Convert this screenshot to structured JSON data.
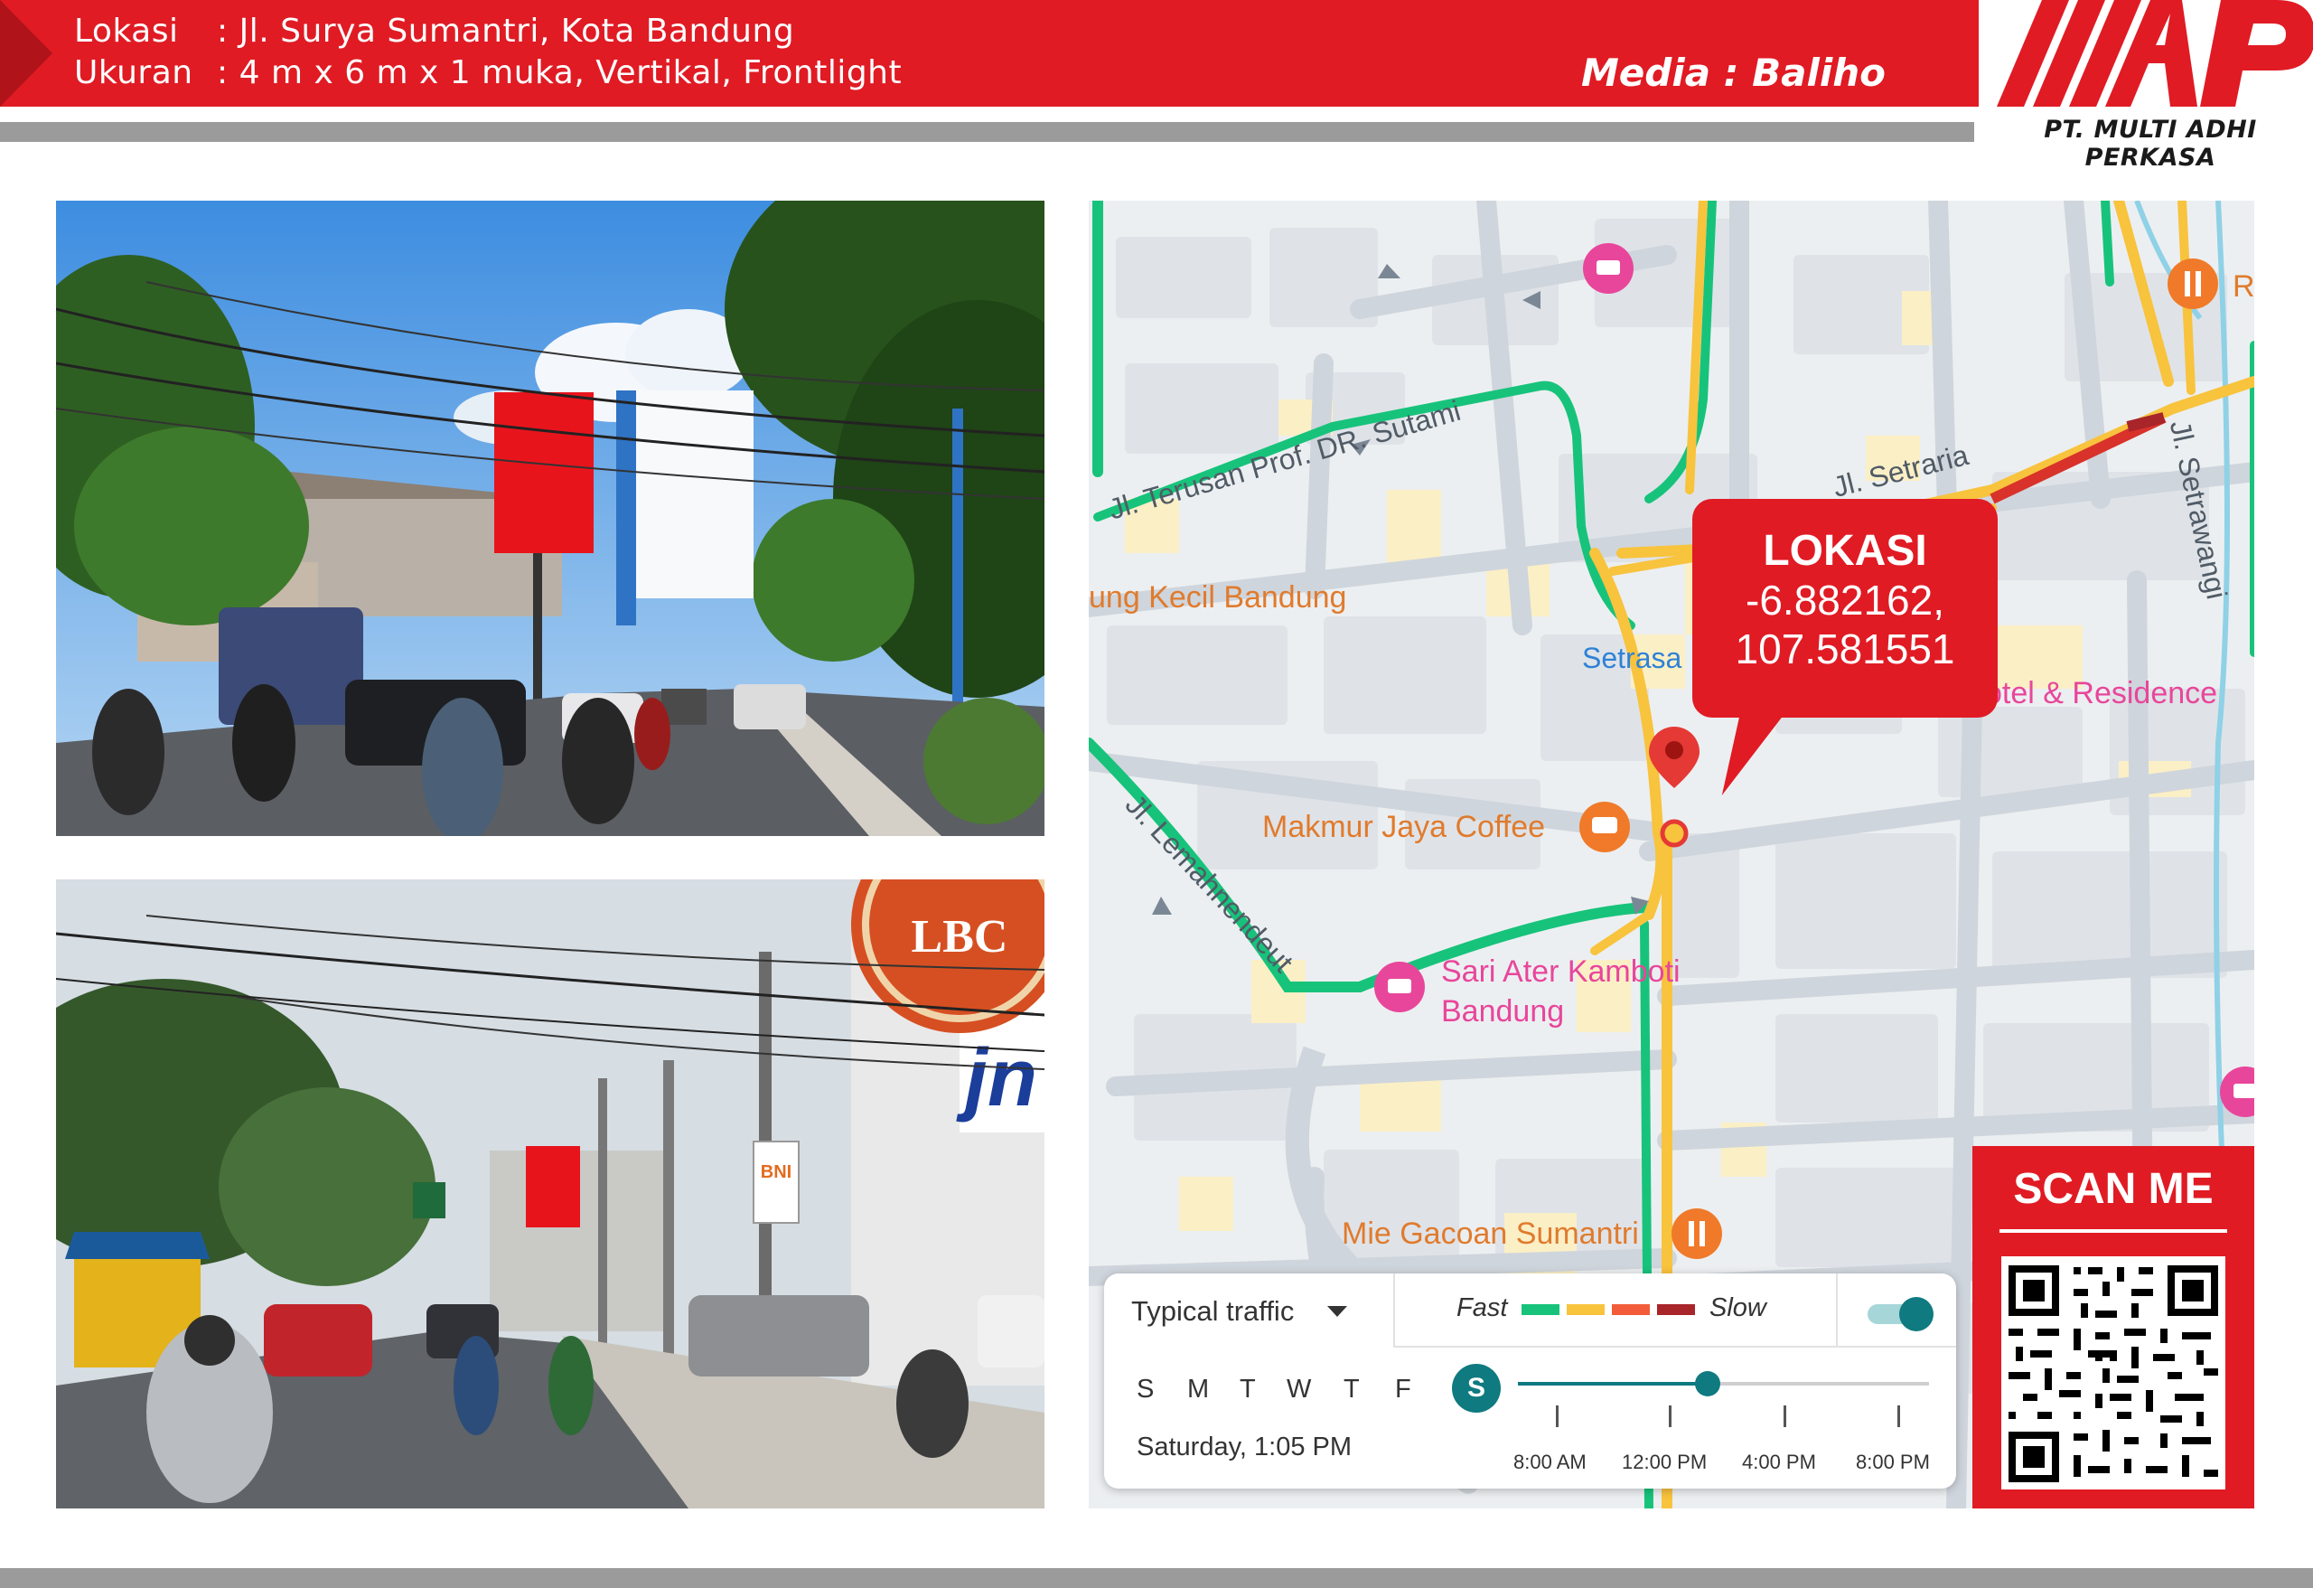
{
  "header": {
    "lokasi_label": "Lokasi",
    "lokasi_sep": ":",
    "lokasi_value": "Jl. Surya Sumantri, Kota Bandung",
    "ukuran_label": "Ukuran",
    "ukuran_sep": ":",
    "ukuran_value": "4 m x 6 m x 1 muka, Vertikal, Frontlight",
    "media": "Media : Baliho",
    "logo_text": "MAP",
    "company": "PT. MULTI ADHI PERKASA"
  },
  "photos": {
    "top_sign": "",
    "bottom_sign": "LBC",
    "bank_sign": "BNI",
    "jne_sign": "jn"
  },
  "map": {
    "roads": {
      "sutami": "Jl. Terusan Prof. DR. Sutami",
      "setraria": "Jl. Setraria",
      "setrawangi": "Jl. Setrawangi",
      "lemahnendeut": "Jl. Lemahnendeut"
    },
    "places": {
      "kecil": "ung Kecil Bandung",
      "setrasari": "Setrasa",
      "hotel": "otel & Residence",
      "makmur": "Makmur Jaya Coffee",
      "sari_1": "Sari Ater Kamboti",
      "sari_2": "Bandung",
      "mie": "Mie Gacoan Sumantri",
      "r_edge": "R"
    },
    "callout": {
      "title": "LOKASI",
      "lat": "-6.882162,",
      "lng": "107.581551"
    },
    "traffic": {
      "mode": "Typical traffic",
      "fast": "Fast",
      "slow": "Slow",
      "days": [
        "S",
        "M",
        "T",
        "W",
        "T",
        "F",
        "S"
      ],
      "selected_day": "S",
      "datetime": "Saturday, 1:05 PM",
      "times": [
        "8:00 AM",
        "12:00 PM",
        "4:00 PM",
        "8:00 PM"
      ],
      "colors": {
        "fast": "#17c37b",
        "mid": "#f8c33d",
        "slow1": "#f25c3b",
        "slow2": "#a8252a"
      },
      "toggle_on": true
    }
  },
  "scan": {
    "title": "SCAN ME"
  },
  "colors": {
    "brand_red": "#e01b24",
    "gray_bar": "#9b9b9b",
    "teal": "#0f7a80"
  }
}
